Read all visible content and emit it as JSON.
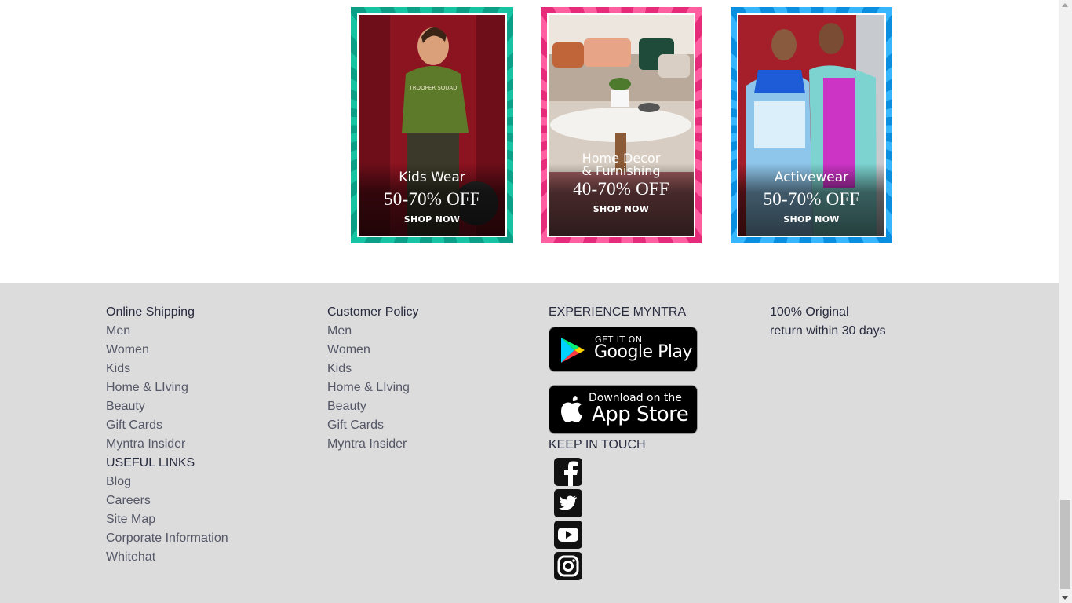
{
  "banners": [
    {
      "title": "Kids Wear",
      "offer": "50-70% OFF",
      "cta": "SHOP NOW",
      "frame_color": "#0a9f86"
    },
    {
      "title_line1": "Home Decor",
      "title_line2": "& Furnishing",
      "offer": "40-70% OFF",
      "cta": "SHOP NOW",
      "frame_color": "#e62b7a"
    },
    {
      "title": "Activewear",
      "offer": "50-70% OFF",
      "cta": "SHOP NOW",
      "frame_color": "#0a8fe0"
    }
  ],
  "footer": {
    "online_shopping": {
      "heading": "Online Shipping",
      "links": [
        "Men",
        "Women",
        "Kids",
        "Home & LIving",
        "Beauty",
        "Gift Cards",
        "Myntra Insider"
      ]
    },
    "useful_links": {
      "heading": "USEFUL LINKS",
      "links": [
        "Blog",
        "Careers",
        "Site Map",
        "Corporate Information",
        "Whitehat"
      ]
    },
    "customer_policy": {
      "heading": "Customer Policy",
      "links": [
        "Men",
        "Women",
        "Kids",
        "Home & LIving",
        "Beauty",
        "Gift Cards",
        "Myntra Insider"
      ]
    },
    "experience": {
      "heading": "EXPERIENCE MYNTRA",
      "google_play": {
        "small": "GET IT ON",
        "big": "Google Play"
      },
      "app_store": {
        "small": "Download on the",
        "big": "App Store"
      }
    },
    "keep_in_touch": {
      "heading": "KEEP IN TOUCH",
      "icons": [
        "facebook-icon",
        "twitter-icon",
        "youtube-icon",
        "instagram-icon"
      ]
    },
    "promises": {
      "line1": "100% Original",
      "line2": "return within 30 days"
    }
  },
  "colors": {
    "footer_bg": "#dddcdd",
    "link_text": "#535766",
    "heading_text": "#282c3f"
  }
}
